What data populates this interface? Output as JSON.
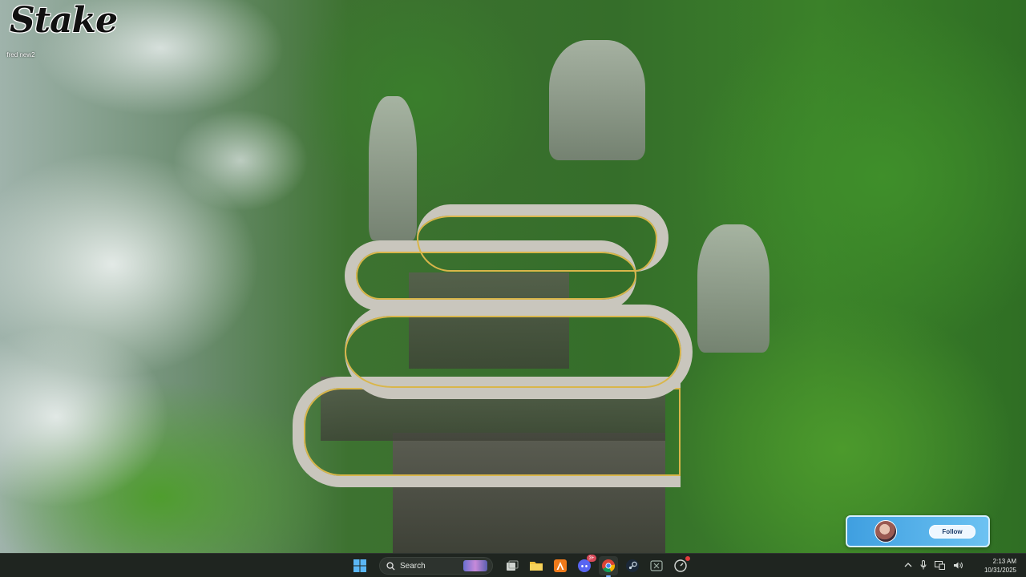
{
  "desktop": {
    "brand_logo_text": "Stake",
    "icon_label": "fred new2"
  },
  "widget": {
    "follow_label": "Follow"
  },
  "taskbar": {
    "search_placeholder": "Search",
    "discord_badge": "3+",
    "clock_time": "2:13 AM",
    "clock_date": "10/31/2025",
    "pinned_apps": [
      "start-icon",
      "search",
      "task-view-icon",
      "file-explorer-icon",
      "app-orange-icon",
      "discord-icon",
      "chrome-icon",
      "steam-icon",
      "xbox-icon",
      "app-red-dot-icon"
    ],
    "tray_icons": [
      "chevron-up-icon",
      "microphone-icon",
      "network-icon",
      "volume-icon"
    ]
  },
  "colors": {
    "taskbar_bg": "#1f2520",
    "widget_accent": "#3f9fe0",
    "brand_text": "#111111"
  }
}
